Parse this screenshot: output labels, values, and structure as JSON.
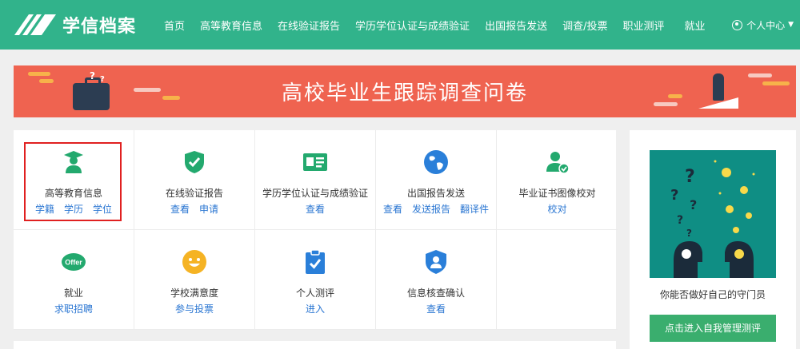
{
  "brand": {
    "name": "学信档案",
    "color": "#31b38b"
  },
  "nav": {
    "items": [
      "首页",
      "高等教育信息",
      "在线验证报告",
      "学历学位认证与成绩验证",
      "出国报告发送",
      "调查/投票",
      "职业测评",
      "就业"
    ],
    "user_label": "个人中心"
  },
  "banner": {
    "title": "高校毕业生跟踪调查问卷",
    "color": "#ef6350"
  },
  "services": [
    {
      "title": "高等教育信息",
      "links": [
        "学籍",
        "学历",
        "学位"
      ],
      "icon": "graduate-icon"
    },
    {
      "title": "在线验证报告",
      "links": [
        "查看",
        "申请"
      ],
      "icon": "shield-check-icon"
    },
    {
      "title": "学历学位认证与成绩验证",
      "links": [
        "查看"
      ],
      "icon": "id-card-icon"
    },
    {
      "title": "出国报告发送",
      "links": [
        "查看",
        "发送报告",
        "翻译件"
      ],
      "icon": "globe-icon"
    },
    {
      "title": "毕业证书图像校对",
      "links": [
        "校对"
      ],
      "icon": "user-check-icon"
    },
    {
      "title": "就业",
      "links": [
        "求职招聘"
      ],
      "icon": "offer-icon"
    },
    {
      "title": "学校满意度",
      "links": [
        "参与投票"
      ],
      "icon": "smiley-icon"
    },
    {
      "title": "个人测评",
      "links": [
        "进入"
      ],
      "icon": "clipboard-check-icon"
    },
    {
      "title": "信息核查确认",
      "links": [
        "查看"
      ],
      "icon": "user-shield-icon"
    }
  ],
  "side": {
    "caption": "你能否做好自己的守门员",
    "button": "点击进入自我管理测评"
  },
  "colors": {
    "link": "#2a76d2",
    "highlight_border": "#e02020",
    "button": "#3aae6e"
  }
}
